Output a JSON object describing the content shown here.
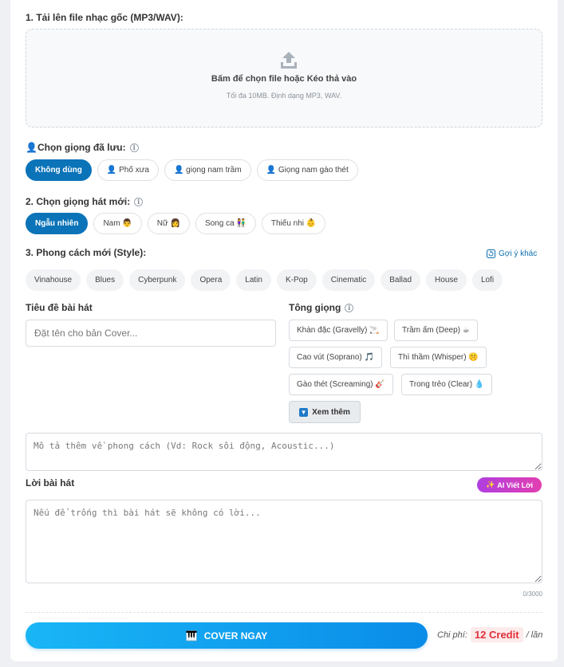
{
  "upload": {
    "label": "1. Tải lên file nhạc gốc (MP3/WAV):",
    "title": "Bấm để chọn file hoặc Kéo thả vào",
    "subtitle": "Tối đa 10MB. Định dạng MP3, WAV."
  },
  "saved_voice": {
    "label": "👤Chọn giọng đã lưu:",
    "options": [
      "Không dùng",
      "👤 Phố xưa",
      "👤 giọng nam trầm",
      "👤 Giọng nam gào thét"
    ],
    "selected": "Không dùng"
  },
  "new_voice": {
    "label": "2. Chọn giọng hát mới:",
    "options": [
      "Ngẫu nhiên",
      "Nam 👨",
      "Nữ 👩",
      "Song ca 👫",
      "Thiếu nhi 👶"
    ],
    "selected": "Ngẫu nhiên"
  },
  "style": {
    "label": "3. Phong cách mới (Style):",
    "suggest_label": "Gợi ý khác",
    "options": [
      "Vinahouse",
      "Blues",
      "Cyberpunk",
      "Opera",
      "Latin",
      "K-Pop",
      "Cinematic",
      "Ballad",
      "House",
      "Lofi"
    ]
  },
  "song_title": {
    "label": "Tiêu đề bài hát",
    "placeholder": "Đặt tên cho bản Cover..."
  },
  "tone": {
    "label": "Tông giọng",
    "options": [
      "Khàn đặc (Gravelly) 🚬",
      "Trầm ấm (Deep) ☕",
      "Cao vút (Soprano) 🎵",
      "Thì thầm (Whisper) 🤫",
      "Gào thét (Screaming) 🎸",
      "Trong trẻo (Clear) 💧"
    ],
    "more_label": "Xem thêm"
  },
  "description": {
    "placeholder": "Mô tả thêm về phong cách (Vd: Rock sôi động, Acoustic...)"
  },
  "lyrics": {
    "label": "Lời bài hát",
    "ai_button": "AI Viết Lời",
    "placeholder": "Nếu để trống thì bài hát sẽ không có lời...",
    "counter": "0/3000"
  },
  "submit": {
    "label": "COVER NGAY",
    "cost_prefix": "Chi phí:",
    "cost_value": "12 Credit",
    "cost_suffix": "/ lần"
  },
  "colors": {
    "primary": "#0b73b8",
    "button_gradient_start": "#19b6f6",
    "button_gradient_end": "#0a8ce8",
    "credit_red": "#e0303a",
    "ai_gradient_start": "#b03ee0",
    "ai_gradient_end": "#e23fb0"
  }
}
